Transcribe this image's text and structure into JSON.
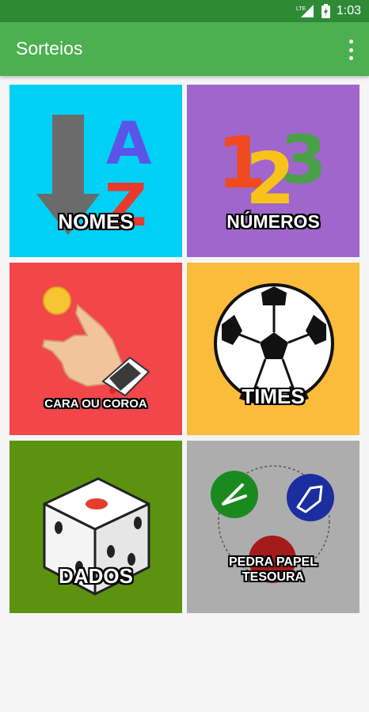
{
  "status_bar": {
    "time": "1:03",
    "network": "LTE"
  },
  "app_bar": {
    "title": "Sorteios",
    "menu_icon": "more-vert-icon"
  },
  "tiles": [
    {
      "label": "NOMES",
      "color": "#00d0f5"
    },
    {
      "label": "NÚMEROS",
      "color": "#a066cc"
    },
    {
      "label": "CARA OU COROA",
      "color": "#f2464b"
    },
    {
      "label": "TIMES",
      "color": "#fbbb3b"
    },
    {
      "label": "DADOS",
      "color": "#5b9311"
    },
    {
      "label": "PEDRA PAPEL",
      "label2": "TESOURA",
      "color": "#adadad"
    }
  ],
  "accent_color": "#4caf50"
}
